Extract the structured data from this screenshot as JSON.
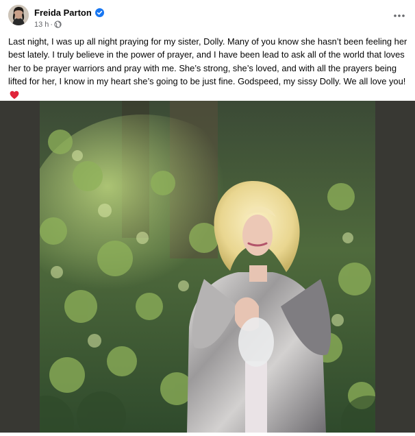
{
  "post": {
    "author": "Freida Parton",
    "timestamp": "13 h",
    "separator": "·",
    "text": "Last night, I was up all night praying for my sister, Dolly. Many of you know she hasn’t been feeling her best lately. I truly believe in the power of prayer, and I have been lead to ask all of the world that loves her to be prayer warriors and pray with me. She’s strong, she’s loved, and with all the prayers being lifted for her, I know in my heart she’s going to be just fine. Godspeed, my sissy Dolly. We all love you!",
    "icons": {
      "verified": "verified-badge-icon",
      "audience": "globe-icon",
      "more": "more-options-icon",
      "emoji": "red-heart-icon"
    }
  },
  "colors": {
    "verified": "#1877f2",
    "heart": "#e0243a",
    "meta_text": "#65676b",
    "media_background": "#383833"
  }
}
